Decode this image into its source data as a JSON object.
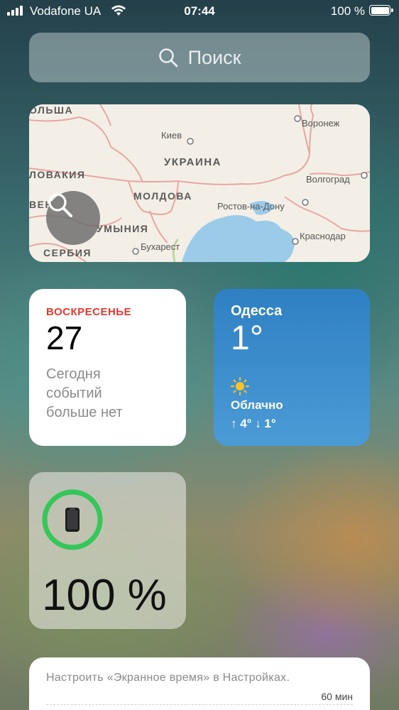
{
  "status_bar": {
    "carrier": "Vodafone UA",
    "time": "07:44",
    "battery": "100 %",
    "icons": [
      "signal-bars-icon",
      "wifi-icon",
      "battery-icon"
    ]
  },
  "search": {
    "placeholder": "Поиск",
    "icon": "magnifier-icon"
  },
  "map": {
    "labels": {
      "poland": "ОЛЬША",
      "slovakia": "ЛОВАКИЯ",
      "ukraine": "УКРАИНА",
      "moldova": "МОЛДОВА",
      "romania": "УМЫНИЯ",
      "serbia": "СЕРБИЯ",
      "ven": "ВЕН",
      "kyiv": "Киев",
      "voronezh": "Воронеж",
      "volgograd": "Волгоград",
      "rostov": "Ростов-на-Дону",
      "krasnodar": "Краснодар",
      "bucharest": "Бухарест"
    },
    "search_icon": "magnifier-icon"
  },
  "calendar": {
    "weekday": "ВОСКРЕСЕНЬЕ",
    "date": "27",
    "note_line1": "Сегодня",
    "note_line2": "событий",
    "note_line3": "больше нет"
  },
  "weather": {
    "city": "Одесса",
    "temperature": "1°",
    "condition": "Облачно",
    "range": "↑ 4° ↓ 1°",
    "icon": "sun-icon",
    "colors": {
      "top": "#2f80c3",
      "bottom": "#4b9bd6"
    }
  },
  "battery_widget": {
    "percent": "100 %",
    "level": 1.0,
    "device_icon": "iphone-icon",
    "ring_color": "#34c759"
  },
  "screen_time": {
    "text": "Настроить «Экранное время» в Настройках.",
    "axis_label": "60 мин"
  },
  "colors": {
    "calendar_accent": "#e8382d"
  }
}
